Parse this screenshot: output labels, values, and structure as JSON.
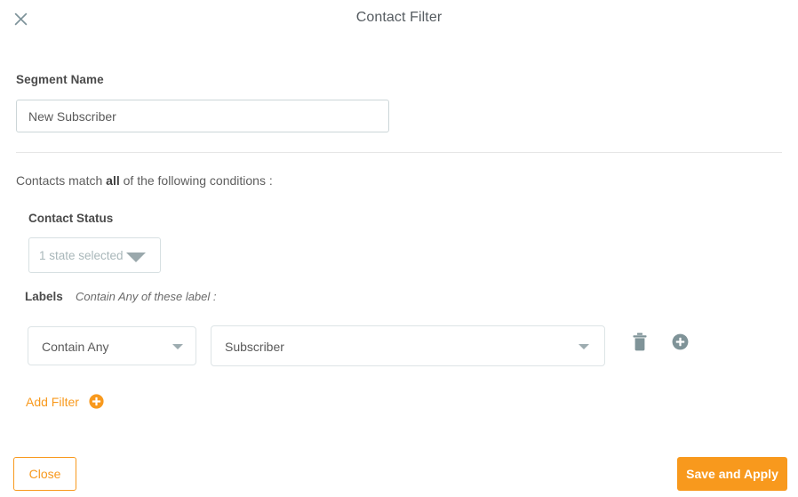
{
  "header": {
    "title": "Contact Filter",
    "close_icon": "close-x-icon"
  },
  "segment": {
    "label": "Segment Name",
    "value": "New Subscriber",
    "placeholder": "New Subscriber"
  },
  "conditions": {
    "prefix": "Contacts match ",
    "emphasis": "all",
    "suffix": " of the following conditions :"
  },
  "contact_status": {
    "label": "Contact Status",
    "selected_text": "1 state selected",
    "caret_icon": "triangle-down-icon"
  },
  "labels": {
    "label": "Labels",
    "hint": "Contain Any of these label :",
    "filter_row": {
      "operator_value": "Contain Any",
      "operator_caret_icon": "chevron-down-icon",
      "value_value": "Subscriber",
      "value_caret_icon": "chevron-down-icon",
      "delete_icon": "trash-icon",
      "add_icon": "circle-plus-icon"
    }
  },
  "add_filter": {
    "label": "Add Filter",
    "icon": "circle-plus-icon"
  },
  "footer": {
    "close_label": "Close",
    "save_label": "Save and Apply"
  },
  "colors": {
    "accent_orange": "#f8991d",
    "icon_gray": "#7f9398",
    "border_gray": "#dde4e6",
    "text_dark": "#4b4b4b"
  }
}
